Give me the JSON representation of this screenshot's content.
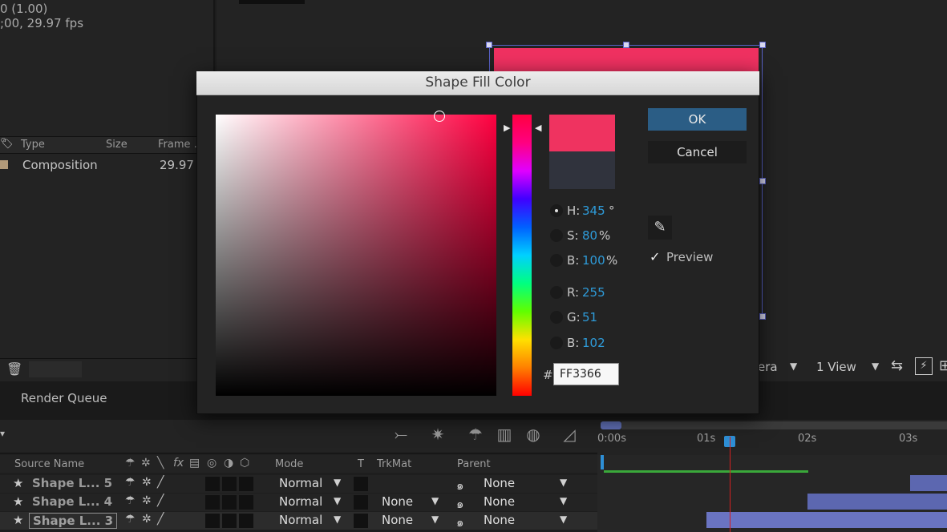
{
  "project": {
    "info_line1": "0 (1.00)",
    "info_line2": ";00, 29.97 fps",
    "columns": [
      "Type",
      "Size",
      "Frame ..."
    ],
    "row": {
      "type": "Composition",
      "frame": "29.97"
    }
  },
  "viewer": {
    "camera_label": "era",
    "view_label": "1 View"
  },
  "panels": {
    "render_queue": "Render Queue"
  },
  "timeline": {
    "headers": {
      "source_name": "Source Name",
      "mode": "Mode",
      "t": "T",
      "trkmat": "TrkMat",
      "parent": "Parent"
    },
    "ruler": [
      "0:00s",
      "01s",
      "02s",
      "03s"
    ],
    "layers": [
      {
        "name": "Shape L... 5",
        "mode": "Normal",
        "trkmat": "",
        "parent": "None"
      },
      {
        "name": "Shape L... 4",
        "mode": "Normal",
        "trkmat": "None",
        "parent": "None"
      },
      {
        "name": "Shape L... 3",
        "mode": "Normal",
        "trkmat": "None",
        "parent": "None"
      }
    ]
  },
  "dialog": {
    "title": "Shape Fill Color",
    "ok_label": "OK",
    "cancel_label": "Cancel",
    "preview_label": "Preview",
    "preview_checked": true,
    "hash": "#",
    "hex_value": "FF3366",
    "new_color": "#FF3366",
    "hsb": {
      "h_label": "H:",
      "h": "345",
      "h_unit": "°",
      "s_label": "S:",
      "s": "80",
      "s_unit": "%",
      "b_label": "B:",
      "b": "100",
      "b_unit": "%"
    },
    "rgb": {
      "r_label": "R:",
      "r": "255",
      "g_label": "G:",
      "g": "51",
      "b_label": "B:",
      "b": "102"
    }
  }
}
